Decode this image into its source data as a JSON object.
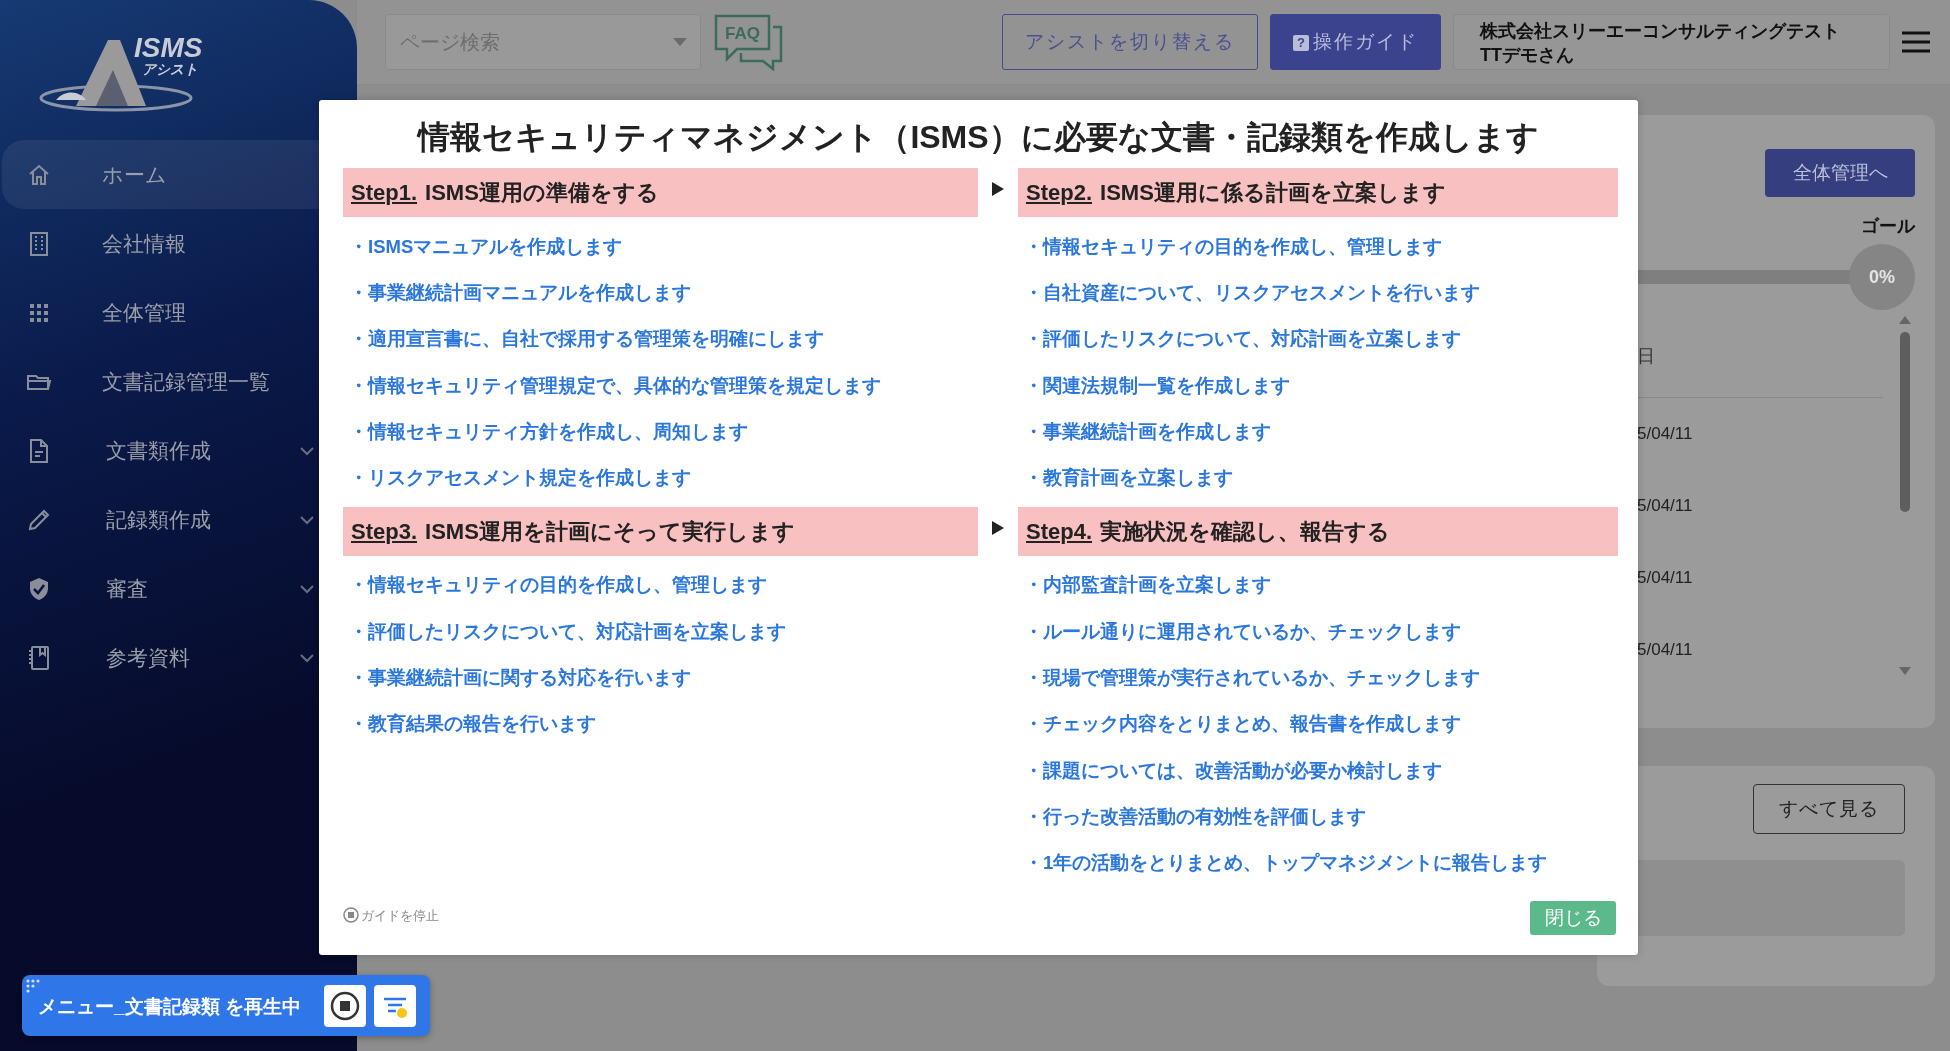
{
  "sidebar": {
    "logo": {
      "title": "ISMS",
      "subtitle": "アシスト"
    },
    "items": [
      {
        "label": "ホーム",
        "selected": true,
        "expandable": false
      },
      {
        "label": "会社情報",
        "selected": false,
        "expandable": false
      },
      {
        "label": "全体管理",
        "selected": false,
        "expandable": false
      },
      {
        "label": "文書記録管理一覧",
        "selected": false,
        "expandable": false
      },
      {
        "label": "文書類作成",
        "selected": false,
        "expandable": true
      },
      {
        "label": "記録類作成",
        "selected": false,
        "expandable": true
      },
      {
        "label": "審査",
        "selected": false,
        "expandable": true
      },
      {
        "label": "参考資料",
        "selected": false,
        "expandable": true
      }
    ]
  },
  "topbar": {
    "page_search": {
      "placeholder": "ページ検索"
    },
    "faq": "FAQ",
    "buttons": [
      {
        "label": "アシストを切り替える",
        "kind": "outline"
      },
      {
        "label": "操作ガイド",
        "kind": "primary",
        "badge": "?"
      }
    ],
    "user": {
      "company": "株式会社スリーエーコンサルティングテスト",
      "name": "TTデモさん"
    }
  },
  "background_cards": {
    "progress": {
      "button": "全体管理へ",
      "goal_label": "ゴール",
      "level": 0,
      "percent": "0%",
      "column_header": "日",
      "dates": [
        "5/04/11",
        "5/04/11",
        "5/04/11",
        "5/04/11"
      ]
    },
    "list": {
      "button": "すべて見る"
    }
  },
  "modal": {
    "title": "情報セキュリティマネジメント（ISMS）に必要な文書・記録類を作成します",
    "steps": [
      {
        "step": "Step1.",
        "title": "ISMS運用の準備をする",
        "items": [
          "・ISMSマニュアルを作成します",
          "・事業継続計画マニュアルを作成します",
          "・適用宣言書に、自社で採用する管理策を明確にします",
          "・情報セキュリティ管理規定で、具体的な管理策を規定します",
          "・情報セキュリティ方針を作成し、周知します",
          "・リスクアセスメント規定を作成します"
        ]
      },
      {
        "step": "Step2.",
        "title": "ISMS運用に係る計画を立案します",
        "items": [
          "・情報セキュリティの目的を作成し、管理します",
          "・自社資産について、リスクアセスメントを行います",
          "・評価したリスクについて、対応計画を立案します",
          "・関連法規制一覧を作成します",
          "・事業継続計画を作成します",
          "・教育計画を立案します"
        ]
      },
      {
        "step": "Step3.",
        "title": "ISMS運用を計画にそって実行します",
        "items": [
          "・情報セキュリティの目的を作成し、管理します",
          "・評価したリスクについて、対応計画を立案します",
          "・事業継続計画に関する対応を行います",
          "・教育結果の報告を行います"
        ]
      },
      {
        "step": "Step4.",
        "title": "実施状況を確認し、報告する",
        "items": [
          "・内部監査計画を立案します",
          "・ルール通りに運用されているか、チェックします",
          "・現場で管理策が実行されているか、チェックします",
          "・チェック内容をとりまとめ、報告書を作成します",
          "・課題については、改善活動が必要か検討します",
          "・行った改善活動の有効性を評価します",
          "・1年の活動をとりまとめ、トップマネジメントに報告します"
        ]
      }
    ],
    "stop_guide": "ガイドを停止",
    "close": "閉じる"
  },
  "player": {
    "text": "メニュー_文書記録類 を再生中"
  }
}
